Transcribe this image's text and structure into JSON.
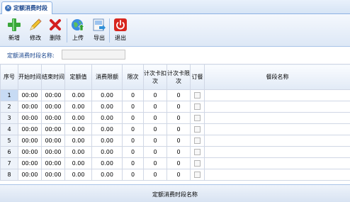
{
  "tab": {
    "title": "定额消费时段",
    "close_icon": "close-icon"
  },
  "toolbar": {
    "new_label": "新增",
    "edit_label": "修改",
    "delete_label": "删除",
    "upload_label": "上传",
    "export_label": "导出",
    "exit_label": "退出"
  },
  "form": {
    "name_label": "定额消费时段名称:",
    "name_value": ""
  },
  "table": {
    "columns": [
      "序号",
      "开始时间",
      "结束时间",
      "定额值",
      "消费限额",
      "限次",
      "计次卡扣次",
      "计次卡限次",
      "订餐",
      "餐段名称"
    ],
    "rows": [
      [
        "1",
        "00:00",
        "00:00",
        "0.00",
        "0.00",
        "0",
        "0",
        "0",
        "",
        ""
      ],
      [
        "2",
        "00:00",
        "00:00",
        "0.00",
        "0.00",
        "0",
        "0",
        "0",
        "",
        ""
      ],
      [
        "3",
        "00:00",
        "00:00",
        "0.00",
        "0.00",
        "0",
        "0",
        "0",
        "",
        ""
      ],
      [
        "4",
        "00:00",
        "00:00",
        "0.00",
        "0.00",
        "0",
        "0",
        "0",
        "",
        ""
      ],
      [
        "5",
        "00:00",
        "00:00",
        "0.00",
        "0.00",
        "0",
        "0",
        "0",
        "",
        ""
      ],
      [
        "6",
        "00:00",
        "00:00",
        "0.00",
        "0.00",
        "0",
        "0",
        "0",
        "",
        ""
      ],
      [
        "7",
        "00:00",
        "00:00",
        "0.00",
        "0.00",
        "0",
        "0",
        "0",
        "",
        ""
      ],
      [
        "8",
        "00:00",
        "00:00",
        "0.00",
        "0.00",
        "0",
        "0",
        "0",
        "",
        ""
      ]
    ]
  },
  "footer": {
    "label": "定额消费时段名称"
  },
  "colors": {
    "accent": "#15428b",
    "toolbar_bg": "#dde8f6",
    "border": "#8db2e3"
  }
}
